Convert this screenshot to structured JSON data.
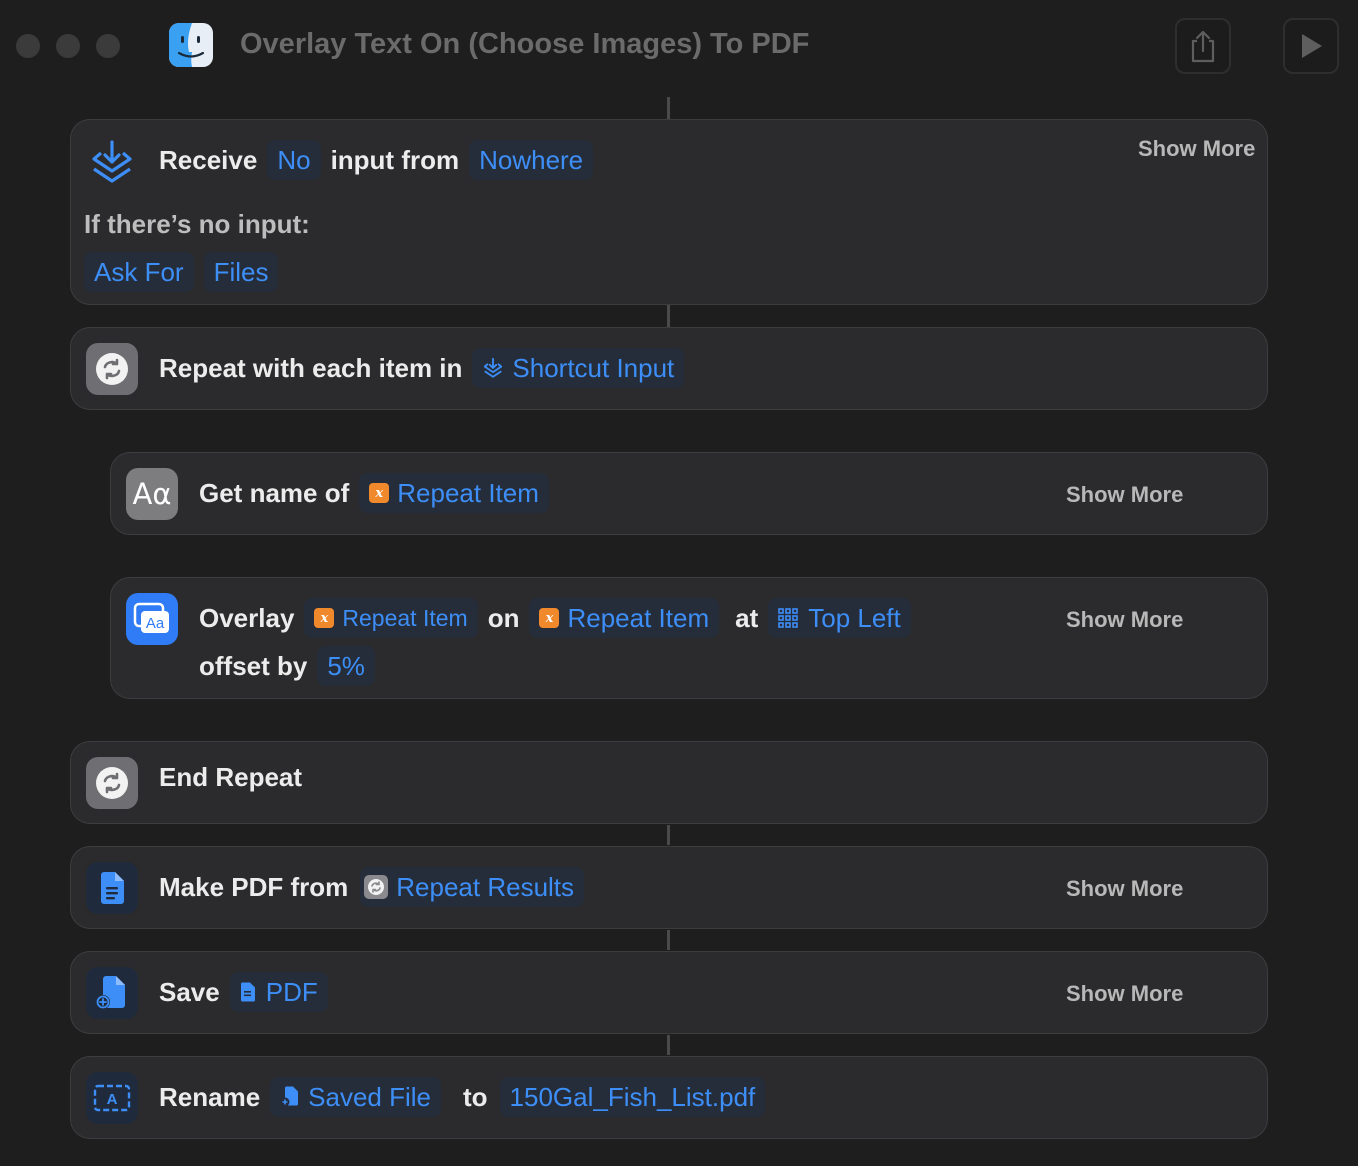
{
  "window": {
    "title": "Overlay Text On (Choose Images) To PDF",
    "share_icon": "share-icon",
    "run_icon": "play-icon"
  },
  "actions": {
    "receive": {
      "word_receive": "Receive",
      "param_no": "No",
      "word_input_from": "input from",
      "param_nowhere": "Nowhere",
      "show_more": "Show More",
      "no_input_label": "If there’s no input:",
      "param_ask_for": "Ask For",
      "param_files": "Files"
    },
    "repeat": {
      "word": "Repeat with each item in",
      "param": "Shortcut Input"
    },
    "get_name": {
      "word": "Get name of",
      "param": "Repeat Item",
      "show_more": "Show More"
    },
    "overlay": {
      "word_overlay": "Overlay",
      "param_text": "Repeat Item",
      "word_on": "on",
      "param_image": "Repeat Item",
      "word_at": "at",
      "param_position": "Top Left",
      "word_offset": "offset by",
      "param_offset": "5%",
      "show_more": "Show More"
    },
    "end_repeat": {
      "word": "End Repeat"
    },
    "make_pdf": {
      "word": "Make PDF from",
      "param": "Repeat Results",
      "show_more": "Show More"
    },
    "save": {
      "word": "Save",
      "param": "PDF",
      "show_more": "Show More"
    },
    "rename": {
      "word_rename": "Rename",
      "param_file": "Saved File",
      "word_to": "to",
      "param_name": "150Gal_Fish_List.pdf"
    }
  },
  "colors": {
    "background": "#1e1e1e",
    "card": "#2b2b2d",
    "accent_blue": "#3d8ef7",
    "variable_orange": "#f0882c",
    "title_gray": "#6b6b6b"
  }
}
